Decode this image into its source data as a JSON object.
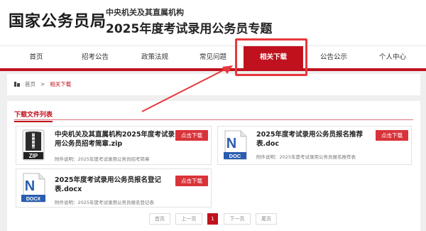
{
  "header": {
    "logo": "国家公务员局",
    "subtitle_1": "中央机关及其直属机构",
    "subtitle_2": "2025年度考试录用公务员专题"
  },
  "nav": {
    "items": [
      {
        "label": "首页"
      },
      {
        "label": "招考公告"
      },
      {
        "label": "政策法规"
      },
      {
        "label": "常见问题"
      },
      {
        "label": "相关下载",
        "active": true
      },
      {
        "label": "公告公示"
      },
      {
        "label": "个人中心"
      }
    ]
  },
  "breadcrumb": {
    "home": "首页",
    "separator": ">",
    "current": "相关下载"
  },
  "section": {
    "title": "下载文件列表"
  },
  "files": [
    {
      "icon": "zip-file-icon",
      "icon_label": "ZIP",
      "title": "中央机关及其直属机构2025年度考试录用公务员招考简章.zip",
      "desc": "附件说明：2025年度考试录用公务员招考简章",
      "button": "点击下载"
    },
    {
      "icon": "word-doc-icon",
      "icon_label": "DOC",
      "title": "2025年度考试录用公务员报名推荐表.doc",
      "desc": "附件说明：2025年度考试录用公务员报名推荐表",
      "button": "点击下载"
    },
    {
      "icon": "word-docx-icon",
      "icon_label": "DOCX",
      "title": "2025年度考试录用公务员报名登记表.docx",
      "desc": "附件说明：2025年度考试录用公务员报名登记表",
      "button": "点击下载"
    }
  ],
  "pagination": {
    "first": "首页",
    "prev": "上一页",
    "page": "1",
    "next": "下一页",
    "last": "尾页"
  },
  "colors": {
    "brand_red": "#c0121e",
    "button_red": "#d9333a",
    "annotation_red": "#e8383d"
  }
}
